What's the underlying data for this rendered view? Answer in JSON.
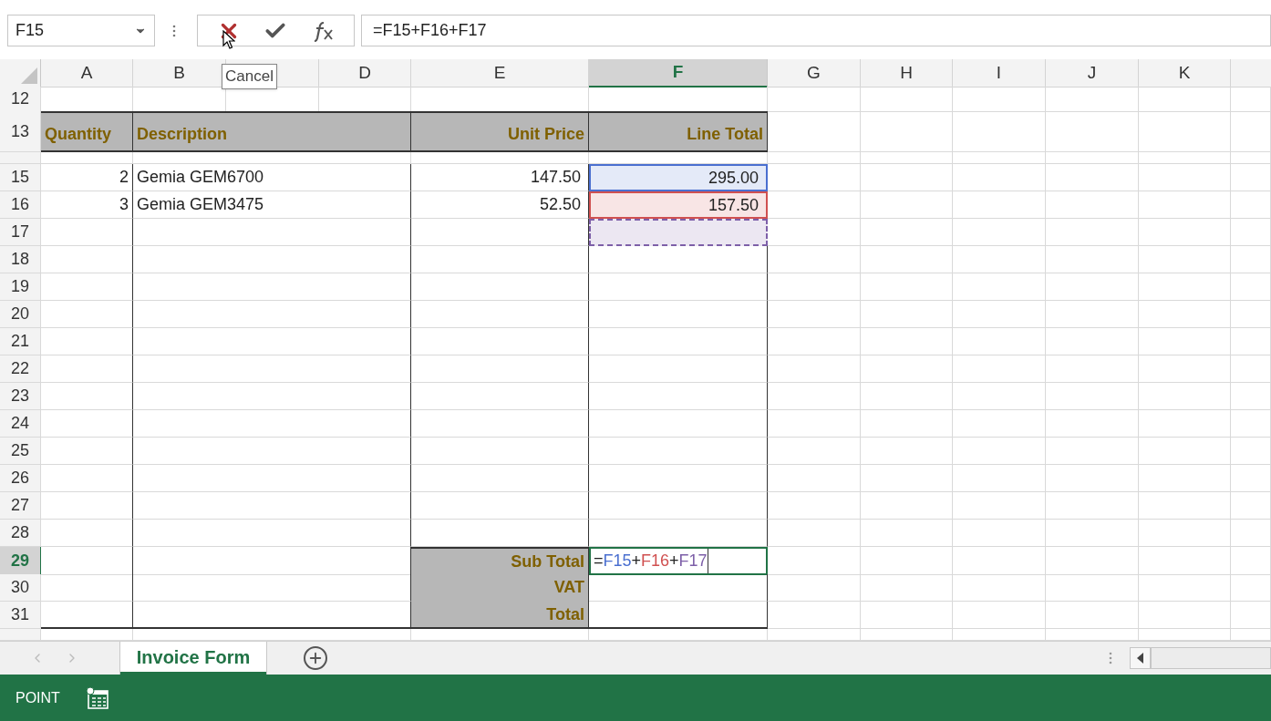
{
  "name_box": {
    "value": "F15"
  },
  "formula_bar": {
    "value": "=F15+F16+F17"
  },
  "tooltip": {
    "text": "Cancel"
  },
  "column_headers": [
    {
      "label": "A",
      "selected": false
    },
    {
      "label": "B",
      "selected": false
    },
    {
      "selected": false
    },
    {
      "label": "D",
      "selected": false
    },
    {
      "label": "E",
      "selected": false
    },
    {
      "label": "F",
      "selected": true
    },
    {
      "label": "G",
      "selected": false
    },
    {
      "label": "H",
      "selected": false
    },
    {
      "label": "I",
      "selected": false
    },
    {
      "label": "J",
      "selected": false
    },
    {
      "label": "K",
      "selected": false
    }
  ],
  "rows": [
    {
      "number": "12",
      "selected": false,
      "kind": "blank"
    },
    {
      "number": "13",
      "selected": false,
      "kind": "header",
      "quantity": "Quantity",
      "description": "Description",
      "unit_price": "Unit Price",
      "line_total": "Line Total"
    },
    {
      "kind": "sliver"
    },
    {
      "number": "15",
      "selected": false,
      "kind": "item",
      "quantity": "2",
      "description": "Gemia GEM6700",
      "unit_price": "147.50",
      "line_total": "295.00",
      "reference": {
        "color": "#4a6fd0",
        "kind": "range"
      }
    },
    {
      "number": "16",
      "selected": false,
      "kind": "item",
      "quantity": "3",
      "description": "Gemia GEM3475",
      "unit_price": "52.50",
      "line_total": "157.50",
      "reference": {
        "color": "#d05050",
        "kind": "range"
      }
    },
    {
      "number": "17",
      "selected": false,
      "kind": "item",
      "reference": {
        "color": "#7d5fa8",
        "kind": "marquee"
      }
    },
    {
      "number": "18",
      "selected": false,
      "kind": "item"
    },
    {
      "number": "19",
      "selected": false,
      "kind": "item"
    },
    {
      "number": "20",
      "selected": false,
      "kind": "item"
    },
    {
      "number": "21",
      "selected": false,
      "kind": "item"
    },
    {
      "number": "22",
      "selected": false,
      "kind": "item"
    },
    {
      "number": "23",
      "selected": false,
      "kind": "item"
    },
    {
      "number": "24",
      "selected": false,
      "kind": "item"
    },
    {
      "number": "25",
      "selected": false,
      "kind": "item"
    },
    {
      "number": "26",
      "selected": false,
      "kind": "item"
    },
    {
      "number": "27",
      "selected": false,
      "kind": "item"
    },
    {
      "number": "28",
      "selected": false,
      "kind": "item"
    },
    {
      "number": "29",
      "selected": true,
      "kind": "summary",
      "label": "Sub Total",
      "editing": [
        {
          "text": "=",
          "color": "#222222"
        },
        {
          "text": "F15",
          "color": "#4a6fd0"
        },
        {
          "text": "+",
          "color": "#222222"
        },
        {
          "text": "F16",
          "color": "#d05050"
        },
        {
          "text": "+",
          "color": "#222222"
        },
        {
          "text": "F17",
          "color": "#7d5fa8"
        }
      ]
    },
    {
      "number": "30",
      "selected": false,
      "kind": "summary",
      "label": "VAT"
    },
    {
      "number": "31",
      "selected": false,
      "kind": "summary",
      "label": "Total"
    },
    {
      "kind": "sliver"
    }
  ],
  "sheet_tabs": [
    {
      "label": "Invoice Form",
      "selected": true
    }
  ],
  "status_bar": {
    "mode": "POINT"
  }
}
